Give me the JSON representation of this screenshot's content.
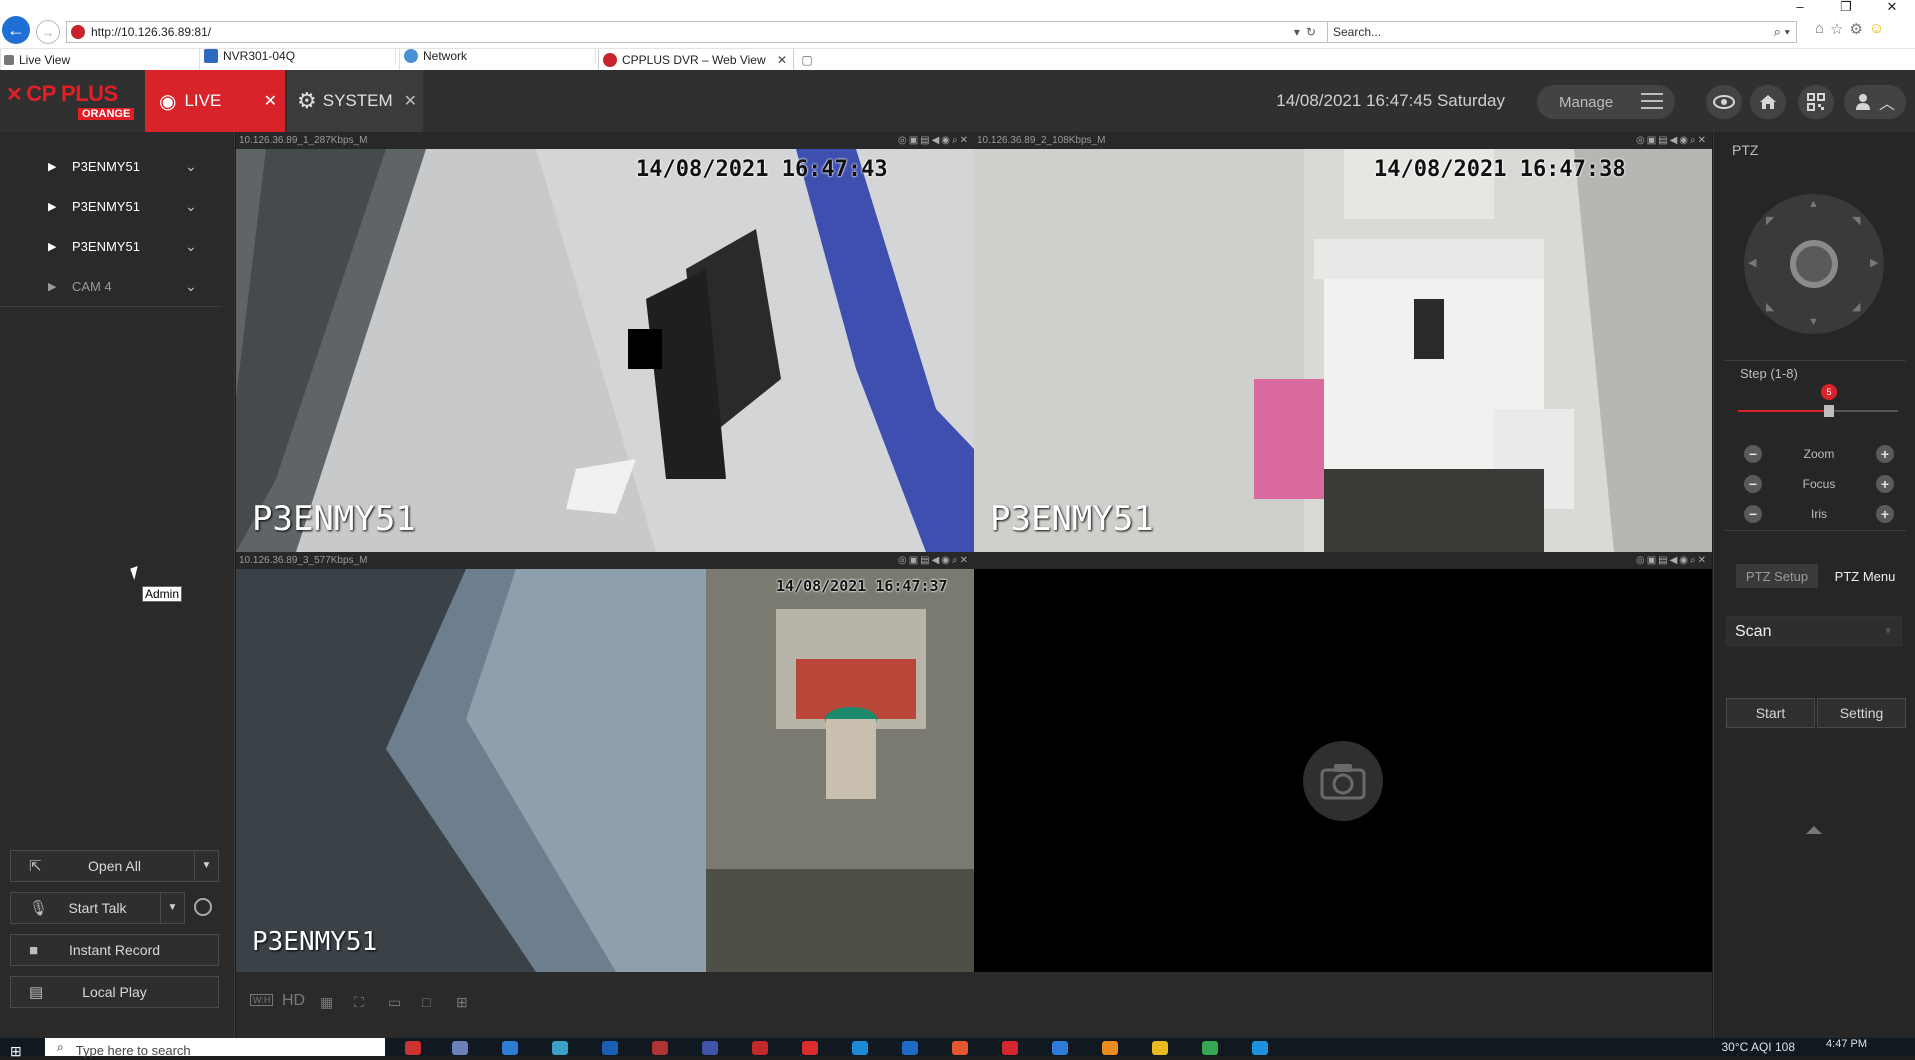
{
  "browser": {
    "url": "http://10.126.36.89:81/",
    "search_placeholder": "Search...",
    "tabs": [
      {
        "label": "Live View"
      },
      {
        "label": "NVR301-04Q"
      },
      {
        "label": "Network"
      },
      {
        "label": "CPPLUS DVR – Web View"
      }
    ]
  },
  "header": {
    "logo_text": "CP PLUS",
    "logo_sub": "ORANGE",
    "live_label": "LIVE",
    "system_label": "SYSTEM",
    "datetime": "14/08/2021 16:47:45 Saturday",
    "manage_label": "Manage"
  },
  "device_tree": {
    "items": [
      {
        "label": "P3ENMY51"
      },
      {
        "label": "P3ENMY51"
      },
      {
        "label": "P3ENMY51"
      },
      {
        "label": "CAM 4"
      }
    ]
  },
  "tooltip": "Admin",
  "left_buttons": {
    "open_all": "Open All",
    "start_talk": "Start Talk",
    "instant_record": "Instant Record",
    "local_play": "Local Play"
  },
  "tiles": [
    {
      "stream": "10.126.36.89_1_287Kbps_M",
      "osd_time": "14/08/2021  16:47:43",
      "osd_name": "P3ENMY51"
    },
    {
      "stream": "10.126.36.89_2_108Kbps_M",
      "osd_time": "14/08/2021  16:47:38",
      "osd_name": "P3ENMY51"
    },
    {
      "stream": "10.126.36.89_3_577Kbps_M",
      "osd_time": "14/08/2021  16:47:37",
      "osd_name": "P3ENMY51"
    },
    {
      "stream": "",
      "osd_time": "",
      "osd_name": ""
    }
  ],
  "bottom_toolbar": {
    "wh_label": "W:H",
    "hd_label": "HD"
  },
  "ptz": {
    "title": "PTZ",
    "step_label": "Step (1-8)",
    "step_value": "5",
    "step_fraction": 0.5714,
    "zoom_label": "Zoom",
    "focus_label": "Focus",
    "iris_label": "Iris",
    "tab_setup": "PTZ Setup",
    "tab_menu": "PTZ Menu",
    "scan_value": "Scan",
    "start_label": "Start",
    "setting_label": "Setting"
  },
  "taskbar": {
    "search_placeholder": "Type here to search",
    "weather": "30°C  AQI 108",
    "time": "4:47 PM"
  },
  "colors": {
    "brand_red": "#d8232a",
    "selection_green": "#2e9a2e"
  }
}
